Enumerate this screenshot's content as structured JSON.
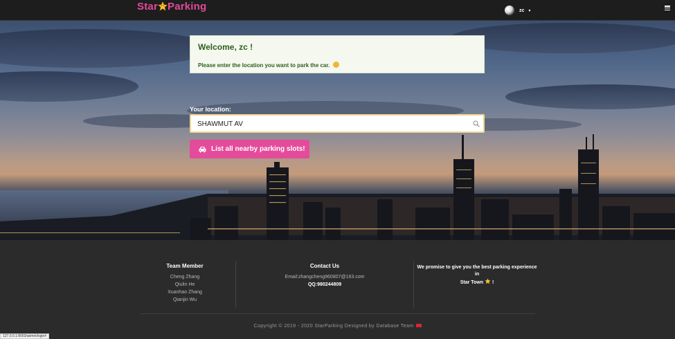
{
  "header": {
    "brand_left": "Star",
    "brand_right": "Parking",
    "username": "zc",
    "caret": "▾",
    "menu_icon": "hamburger-icon"
  },
  "colors": {
    "brand": "#e24a9b",
    "button": "#e54b9b",
    "welcome_text": "#2f5d1f",
    "footer_bg": "#2b2b2b"
  },
  "welcome": {
    "title": "Welcome, zc !",
    "message": "Please enter the location you want to park the car."
  },
  "search": {
    "label": "Your location:",
    "value": "SHAWMUT AV",
    "icon": "search-icon"
  },
  "button": {
    "label": "List all nearby parking slots!",
    "icon": "car-icon"
  },
  "footer": {
    "team_heading": "Team Member",
    "members": [
      "Cheng Zhang",
      "Qiulin He",
      "Xuanhao Zhang",
      "Qianjin Wu"
    ],
    "contact_heading": "Contact Us",
    "email": "Email:zhangcheng960807@163.com",
    "qq": "QQ:980244809",
    "promise_line1": "We promise to give you the best parking experience in",
    "promise_line2": "Star Town",
    "promise_end": "!",
    "copyright": "Copyright © 2019 - 2020 StarParking Designed by Database Team"
  },
  "status_bar": {
    "url": "127.0.0.1:8003/admin/login#"
  }
}
